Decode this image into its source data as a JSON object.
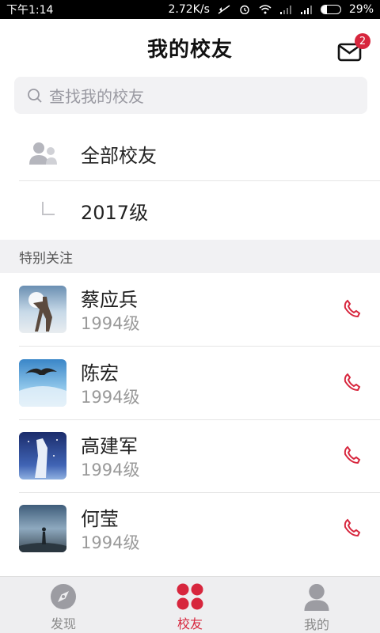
{
  "statusbar": {
    "time": "下午1:14",
    "speed": "2.72K/s",
    "battery": "29%",
    "battery_level": 0.29
  },
  "header": {
    "title": "我的校友",
    "mail_badge": "2"
  },
  "search": {
    "placeholder": "查找我的校友"
  },
  "menu": {
    "all_label": "全部校友",
    "grade_label": "2017级"
  },
  "section": {
    "title": "特别关注"
  },
  "contacts": [
    {
      "name": "蔡应兵",
      "year": "1994级"
    },
    {
      "name": "陈宏",
      "year": "1994级"
    },
    {
      "name": "高建军",
      "year": "1994级"
    },
    {
      "name": "何莹",
      "year": "1994级"
    }
  ],
  "tabs": [
    {
      "label": "发现",
      "icon": "compass-icon",
      "active": false
    },
    {
      "label": "校友",
      "icon": "four-dots-icon",
      "active": true
    },
    {
      "label": "我的",
      "icon": "person-icon",
      "active": false
    }
  ],
  "colors": {
    "accent": "#d7263d",
    "search_bg": "#f2f2f4",
    "section_bg": "#f1f1f3",
    "tabbar_bg": "#eeeef0"
  }
}
